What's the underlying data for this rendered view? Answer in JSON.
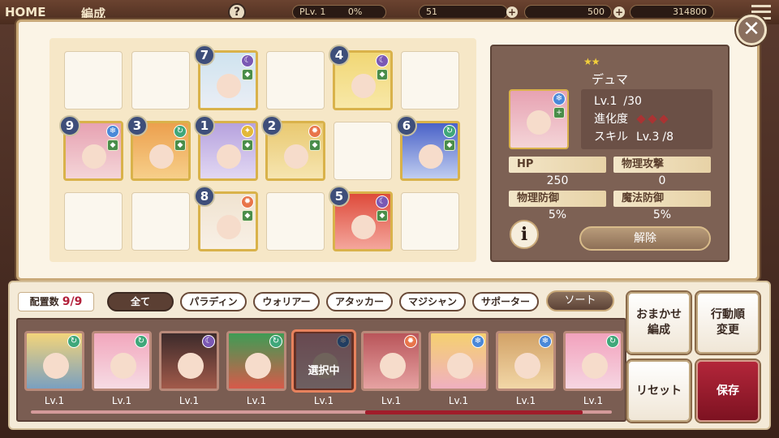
{
  "topbar": {
    "home_label": "HOME",
    "title": "編成",
    "player_level": "PLv. 1",
    "exp_percent": "0%",
    "stamina": "51",
    "gem_count": "500",
    "coin_count": "314800"
  },
  "formation": {
    "empty_cells": [
      {
        "row": 0,
        "col": 0
      },
      {
        "row": 0,
        "col": 1
      },
      {
        "row": 0,
        "col": 3
      },
      {
        "row": 0,
        "col": 5
      },
      {
        "row": 1,
        "col": 4
      },
      {
        "row": 2,
        "col": 0
      },
      {
        "row": 2,
        "col": 1
      },
      {
        "row": 2,
        "col": 3
      },
      {
        "row": 2,
        "col": 5
      }
    ],
    "units": [
      {
        "order": "7",
        "row": 0,
        "col": 2,
        "element": "dark",
        "role": "paladin",
        "palette": [
          "#cfe3ef",
          "#eaeef5"
        ]
      },
      {
        "order": "4",
        "row": 0,
        "col": 4,
        "element": "dark",
        "role": "attacker",
        "palette": [
          "#f1d775",
          "#f8e8a8"
        ]
      },
      {
        "order": "9",
        "row": 1,
        "col": 0,
        "element": "water",
        "role": "supporter",
        "palette": [
          "#e7a2b2",
          "#f4d5d8"
        ]
      },
      {
        "order": "3",
        "row": 1,
        "col": 1,
        "element": "wind",
        "role": "attacker",
        "palette": [
          "#eca04e",
          "#f7cf8a"
        ]
      },
      {
        "order": "1",
        "row": 1,
        "col": 2,
        "element": "light",
        "role": "mage",
        "palette": [
          "#b6a2de",
          "#e2d8f3"
        ]
      },
      {
        "order": "2",
        "row": 1,
        "col": 3,
        "element": "fire",
        "role": "attacker",
        "palette": [
          "#e9c971",
          "#f6e5b0"
        ]
      },
      {
        "order": "6",
        "row": 1,
        "col": 5,
        "element": "wind",
        "role": "mage",
        "palette": [
          "#4a62c8",
          "#c0cdf0"
        ]
      },
      {
        "order": "8",
        "row": 2,
        "col": 2,
        "element": "fire",
        "role": "paladin",
        "palette": [
          "#f0e3d0",
          "#f8f0e6"
        ]
      },
      {
        "order": "5",
        "row": 2,
        "col": 4,
        "element": "dark",
        "role": "attacker",
        "palette": [
          "#de4b3b",
          "#f4a69c"
        ]
      }
    ]
  },
  "detail": {
    "stars": "★★",
    "name": "デュマ",
    "level_label": "Lv.1",
    "level_max": "/30",
    "evolution_label": "進化度",
    "skill_label": "スキル",
    "skill_level": "Lv.3",
    "skill_max": "/8",
    "stats": [
      {
        "label": "HP",
        "value": "250"
      },
      {
        "label": "物理攻撃",
        "value": "0"
      },
      {
        "label": "物理防御",
        "value": "5%"
      },
      {
        "label": "魔法防御",
        "value": "5%"
      }
    ],
    "info_label": "i",
    "release_label": "解除"
  },
  "close_label": "✕",
  "bottom": {
    "count_label": "配置数",
    "count_value": "9/9",
    "filters": [
      "全て",
      "パラディン",
      "ウォリアー",
      "アタッカー",
      "マジシャン",
      "サポーター"
    ],
    "sort_label": "ソート",
    "selected_label": "選択中",
    "roster": [
      {
        "level": "Lv.1",
        "element": "wind",
        "palette": [
          "#f3d47a",
          "#7aa0c0"
        ]
      },
      {
        "level": "Lv.1",
        "element": "wind",
        "palette": [
          "#f2a7bd",
          "#f6dce4"
        ]
      },
      {
        "level": "Lv.1",
        "element": "dark",
        "palette": [
          "#3d2b2b",
          "#a25a4a"
        ]
      },
      {
        "level": "Lv.1",
        "element": "wind",
        "palette": [
          "#3f9c55",
          "#d75a4a"
        ]
      },
      {
        "level": "Lv.1",
        "element": "water",
        "palette": [
          "#e7a2b2",
          "#f4d5d8"
        ],
        "selected": true
      },
      {
        "level": "Lv.1",
        "element": "fire",
        "palette": [
          "#b9555a",
          "#e6a2a2"
        ]
      },
      {
        "level": "Lv.1",
        "element": "water",
        "palette": [
          "#f5d070",
          "#f0b0c0"
        ]
      },
      {
        "level": "Lv.1",
        "element": "water",
        "palette": [
          "#d2a267",
          "#f2d7a7"
        ]
      },
      {
        "level": "Lv.1",
        "element": "wind",
        "palette": [
          "#f2a2bd",
          "#f6d6e2"
        ]
      }
    ],
    "actions": {
      "auto_form": "おまかせ\n編成",
      "order_change": "行動順\n変更",
      "reset": "リセット",
      "save": "保存"
    }
  },
  "colors": {
    "fire": "#e8744a",
    "water": "#4a88d8",
    "wind": "#3fa77a",
    "light": "#e3b83a",
    "dark": "#7a58b4"
  }
}
